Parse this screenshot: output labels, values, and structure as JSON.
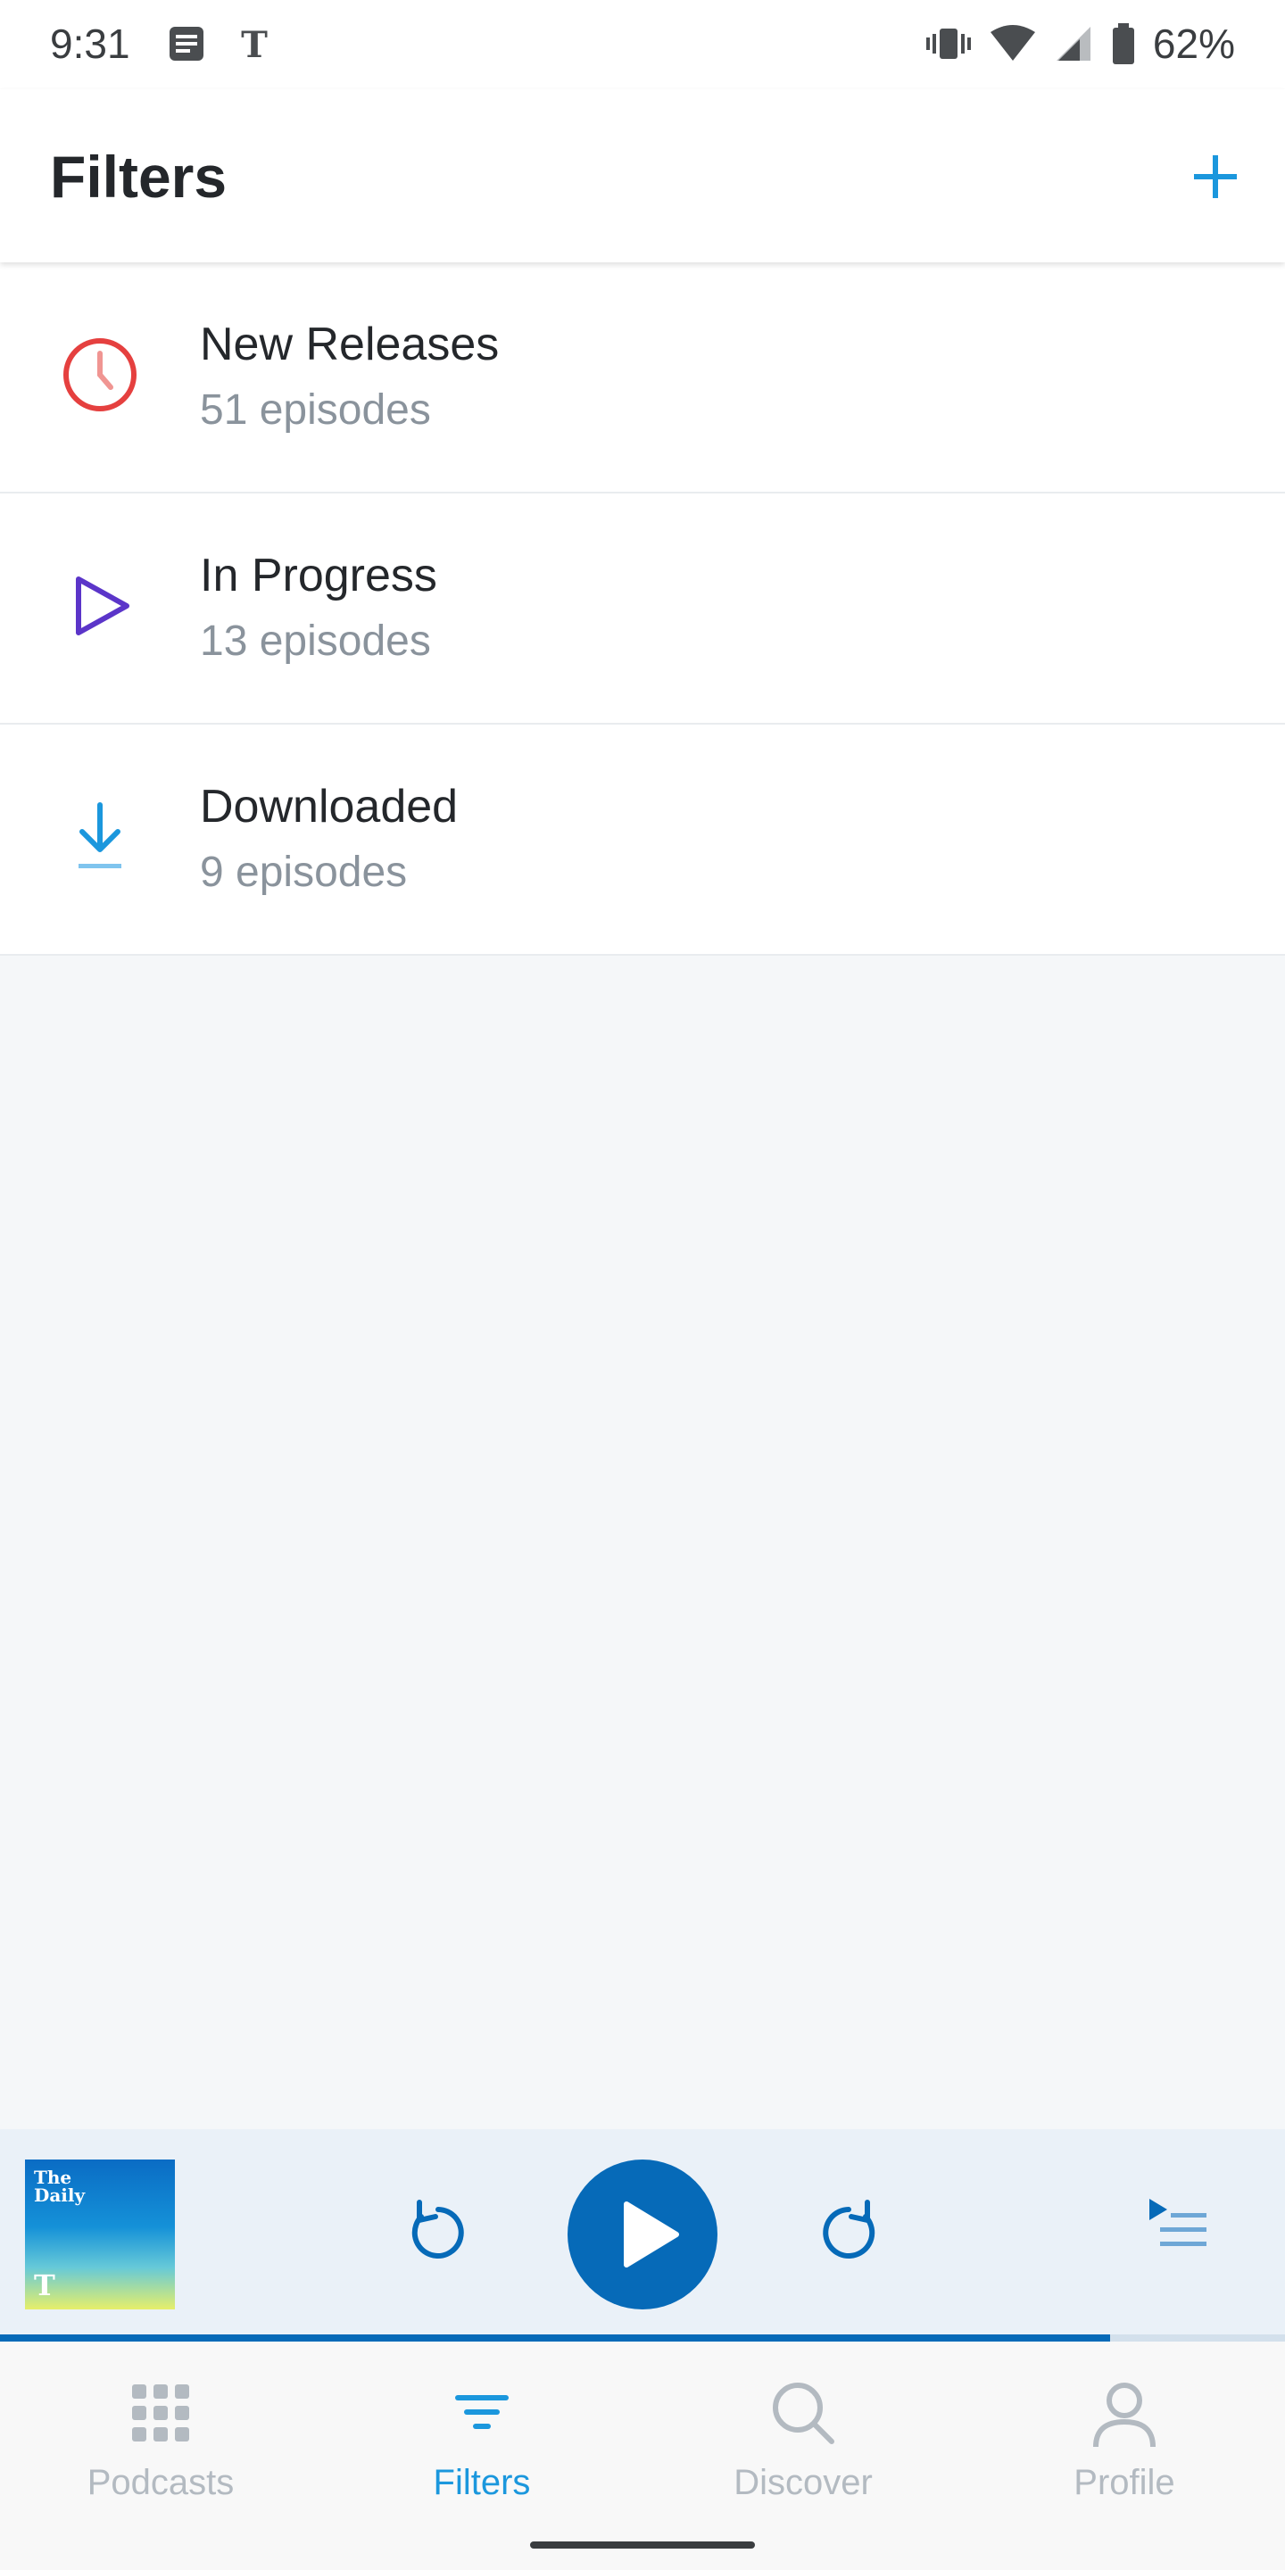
{
  "status_bar": {
    "time": "9:31",
    "battery": "62%",
    "left_icons": [
      "news-app-icon",
      "nyt-logo-icon"
    ],
    "right_icons": [
      "vibrate-icon",
      "wifi-icon",
      "signal-icon",
      "battery-icon"
    ]
  },
  "app_bar": {
    "title": "Filters",
    "add_icon": "plus-icon"
  },
  "filters": [
    {
      "name": "New Releases",
      "count": "51 episodes",
      "icon": "clock-icon",
      "color": "#e5403f"
    },
    {
      "name": "In Progress",
      "count": "13 episodes",
      "icon": "play-outline-icon",
      "color": "#5b35c9"
    },
    {
      "name": "Downloaded",
      "count": "9 episodes",
      "icon": "download-icon",
      "color": "#1b97dd"
    }
  ],
  "mini_player": {
    "artwork_title": "The Daily",
    "artwork_logo": "T",
    "progress": 0.864,
    "accent": "#066ab8"
  },
  "bottom_nav": {
    "items": [
      {
        "label": "Podcasts",
        "icon": "grid-icon",
        "active": false
      },
      {
        "label": "Filters",
        "icon": "filter-icon",
        "active": true
      },
      {
        "label": "Discover",
        "icon": "search-icon",
        "active": false
      },
      {
        "label": "Profile",
        "icon": "person-icon",
        "active": false
      }
    ],
    "active_color": "#1b97dd",
    "inactive_color": "#b3bac1"
  }
}
